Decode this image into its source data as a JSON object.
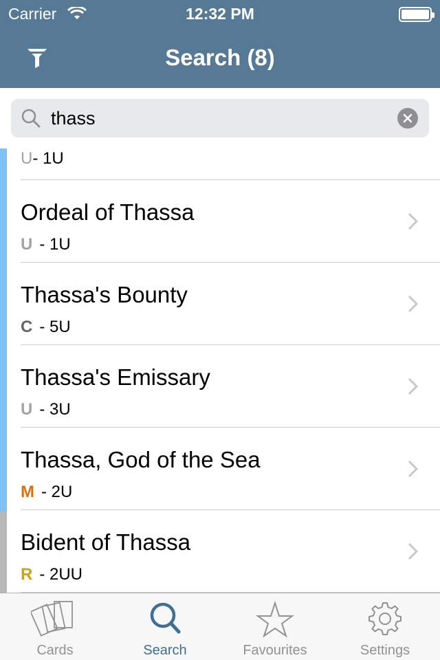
{
  "status": {
    "carrier": "Carrier",
    "time": "12:32 PM"
  },
  "nav": {
    "title": "Search (8)",
    "filter_icon": "filter-icon"
  },
  "search": {
    "value": "thass",
    "placeholder": ""
  },
  "partial_row": {
    "rarity": "U",
    "cost": "- 1U",
    "rarity_color": "#a3a3a3"
  },
  "results": [
    {
      "name": "Ordeal of Thassa",
      "rarity": "U",
      "cost": "- 1U",
      "rarity_color": "#a3a3a3"
    },
    {
      "name": "Thassa's Bounty",
      "rarity": "C",
      "cost": "- 5U",
      "rarity_color": "#666666"
    },
    {
      "name": "Thassa's Emissary",
      "rarity": "U",
      "cost": "- 3U",
      "rarity_color": "#a3a3a3"
    },
    {
      "name": "Thassa, God of the Sea",
      "rarity": "M",
      "cost": "- 2U",
      "rarity_color": "#d9700e"
    },
    {
      "name": "Bident of Thassa",
      "rarity": "R",
      "cost": "- 2UU",
      "rarity_color": "#c9a227"
    }
  ],
  "tabs": [
    {
      "label": "Cards",
      "icon": "cards-icon",
      "active": false
    },
    {
      "label": "Search",
      "icon": "search-icon",
      "active": true
    },
    {
      "label": "Favourites",
      "icon": "star-icon",
      "active": false
    },
    {
      "label": "Settings",
      "icon": "gear-icon",
      "active": false
    }
  ],
  "colors": {
    "header": "#567a96",
    "tab_active": "#3f6f94",
    "tab_inactive": "#929292",
    "scroll_indicator": "#7fc0f5"
  }
}
